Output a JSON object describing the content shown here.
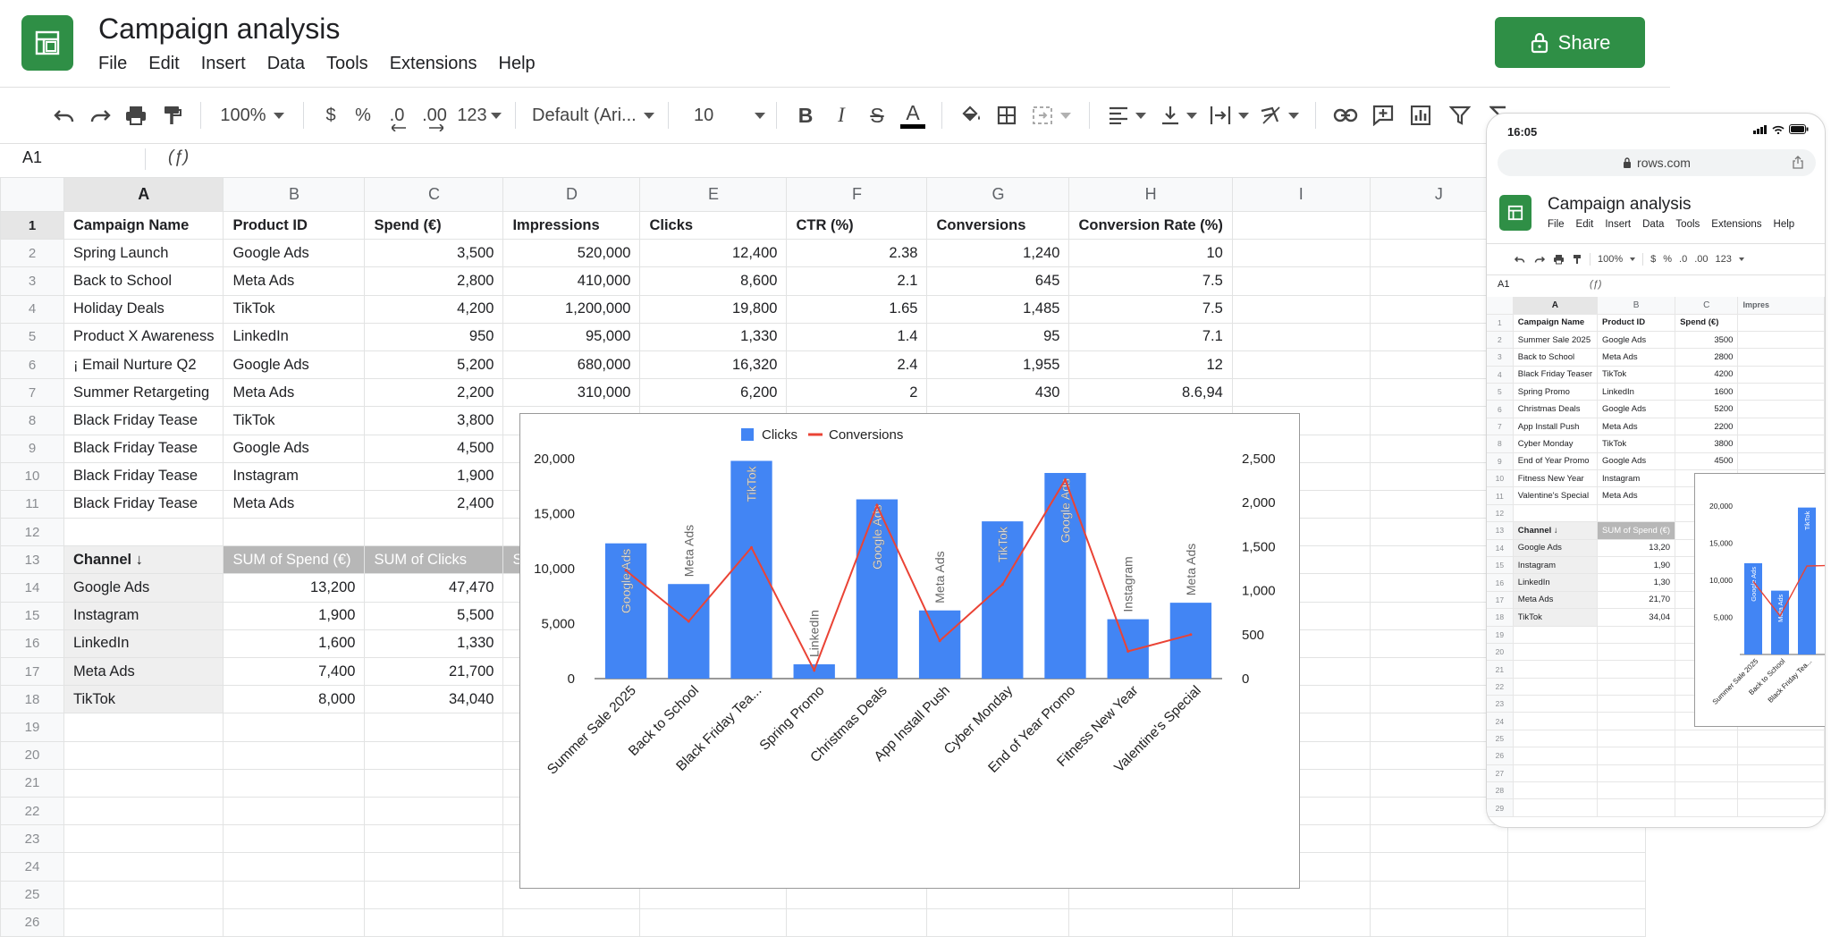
{
  "app": {
    "title": "Campaign analysis",
    "menu": [
      "File",
      "Edit",
      "Insert",
      "Data",
      "Tools",
      "Extensions",
      "Help"
    ],
    "share_label": "Share",
    "brand_color": "#2f8f46"
  },
  "toolbar": {
    "zoom": "100%",
    "currency": "$",
    "percent": "%",
    "decrease_decimals": ".0",
    "increase_decimals": ".00",
    "number_format": "123",
    "font": "Default (Ari...",
    "font_size": "10",
    "bold": "B",
    "italic": "I",
    "strike": "S",
    "text_color": "A"
  },
  "formula_bar": {
    "cell": "A1",
    "fx": "(ƒ)"
  },
  "grid": {
    "columns": [
      "A",
      "B",
      "C",
      "D",
      "E",
      "F",
      "G",
      "H",
      "I",
      "J"
    ],
    "row_numbers": [
      "1",
      "2",
      "3",
      "4",
      "5",
      "6",
      "7",
      "8",
      "9",
      "10",
      "11",
      "12",
      "13",
      "14",
      "15",
      "16",
      "17",
      "18",
      "19",
      "20",
      "21",
      "22",
      "23",
      "24",
      "25",
      "26"
    ],
    "header_row": [
      "Campaign Name",
      "Product ID",
      "Spend (€)",
      "Impressions",
      "Clicks",
      "CTR (%)",
      "Conversions",
      "Conversion Rate (%)"
    ],
    "rows": [
      [
        "Spring Launch",
        "Google Ads",
        "3,500",
        "520,000",
        "12,400",
        "2.38",
        "1,240",
        "10"
      ],
      [
        "Back to School",
        "Meta Ads",
        "2,800",
        "410,000",
        "8,600",
        "2.1",
        "645",
        "7.5"
      ],
      [
        "Holiday Deals",
        "TikTok",
        "4,200",
        "1,200,000",
        "19,800",
        "1.65",
        "1,485",
        "7.5"
      ],
      [
        "Product X Awareness",
        "LinkedIn",
        "950",
        "95,000",
        "1,330",
        "1.4",
        "95",
        "7.1"
      ],
      [
        "¡ Email Nurture Q2",
        "Google Ads",
        "5,200",
        "680,000",
        "16,320",
        "2.4",
        "1,955",
        "12"
      ],
      [
        "Summer Retargeting",
        "Meta Ads",
        "2,200",
        "310,000",
        "6,200",
        "2",
        "430",
        "8.6,94"
      ],
      [
        "Black Friday Tease",
        "TikTok",
        "3,800",
        "",
        "",
        "",
        "",
        ""
      ],
      [
        "Black Friday Tease",
        "Google Ads",
        "4,500",
        "",
        "",
        "",
        "",
        ""
      ],
      [
        "Black Friday Tease",
        "Instagram",
        "1,900",
        "",
        "",
        "",
        "",
        ""
      ],
      [
        "Black Friday Tease",
        "Meta Ads",
        "2,400",
        "",
        "",
        "",
        "",
        ""
      ]
    ],
    "pivot": {
      "headers": [
        "Channel ↓",
        "SUM of Spend (€)",
        "SUM of Clicks",
        "SUM"
      ],
      "rows": [
        [
          "Google Ads",
          "13,200",
          "47,470"
        ],
        [
          "Instagram",
          "1,900",
          "5,500"
        ],
        [
          "LinkedIn",
          "1,600",
          "1,330"
        ],
        [
          "Meta Ads",
          "7,400",
          "21,700"
        ],
        [
          "TikTok",
          "8,000",
          "34,040"
        ]
      ]
    }
  },
  "chart_data": {
    "type": "bar",
    "title": "",
    "legend_position": "top",
    "categories": [
      "Summer Sale 2025",
      "Back to School",
      "Black Friday Tea...",
      "Spring Promo",
      "Christmas Deals",
      "App Install Push",
      "Cyber Monday",
      "End of Year Promo",
      "Fitness New Year",
      "Valentine's Special"
    ],
    "bar_labels": [
      "Google Ads",
      "Meta Ads",
      "TikTok",
      "LinkedIn",
      "Google Ads",
      "Meta Ads",
      "TikTok",
      "Google Ads",
      "Instagram",
      "Meta Ads"
    ],
    "series": [
      {
        "name": "Clicks",
        "type": "bar",
        "axis": "left",
        "color": "#4285f4",
        "values": [
          12300,
          8600,
          19800,
          1300,
          16300,
          6200,
          14300,
          18700,
          5400,
          6900
        ]
      },
      {
        "name": "Conversions",
        "type": "line",
        "axis": "right",
        "color": "#ea4335",
        "values": [
          1230,
          650,
          1490,
          95,
          1970,
          430,
          1070,
          2260,
          310,
          500
        ]
      }
    ],
    "ylim_left": [
      0,
      20000
    ],
    "ylim_right": [
      0,
      2500
    ],
    "yticks_left": [
      "0",
      "5,000",
      "10,000",
      "15,000",
      "20,000"
    ],
    "yticks_right": [
      "0",
      "500",
      "1,000",
      "1,500",
      "2,000",
      "2,500"
    ],
    "grid": false
  },
  "phone": {
    "time": "16:05",
    "url": "rows.com",
    "title": "Campaign analysis",
    "menu": [
      "File",
      "Edit",
      "Insert",
      "Data",
      "Tools",
      "Extensions",
      "Help"
    ],
    "toolbar": {
      "zoom": "100%",
      "currency": "$",
      "percent": "%",
      "decrease_decimals": ".0",
      "increase_decimals": ".00",
      "number_format": "123"
    },
    "formula_bar": {
      "cell": "A1",
      "fx": "(ƒ)"
    },
    "columns": [
      "A",
      "B",
      "C"
    ],
    "extra_col": "Impres",
    "row_numbers": [
      "1",
      "2",
      "3",
      "4",
      "5",
      "6",
      "7",
      "8",
      "9",
      "10",
      "11",
      "12",
      "13",
      "14",
      "15",
      "16",
      "17",
      "18",
      "19",
      "20",
      "21",
      "22",
      "23",
      "24",
      "25",
      "26",
      "27",
      "28",
      "29"
    ],
    "header_row": [
      "Campaign Name",
      "Product ID",
      "Spend (€)"
    ],
    "rows": [
      [
        "Summer Sale 2025",
        "Google Ads",
        "3500"
      ],
      [
        "Back to School",
        "Meta Ads",
        "2800"
      ],
      [
        "Black Friday Teaser",
        "TikTok",
        "4200"
      ],
      [
        "Spring Promo",
        "LinkedIn",
        "1600"
      ],
      [
        "Christmas Deals",
        "Google Ads",
        "5200"
      ],
      [
        "App Install Push",
        "Meta Ads",
        "2200"
      ],
      [
        "Cyber Monday",
        "TikTok",
        "3800"
      ],
      [
        "End of Year Promo",
        "Google Ads",
        "4500"
      ],
      [
        "Fitness New Year",
        "Instagram",
        ""
      ],
      [
        "Valentine's Special",
        "Meta Ads",
        ""
      ]
    ],
    "pivot": {
      "headers": [
        "Channel ↓",
        "SUM of Spend (€)"
      ],
      "rows": [
        [
          "Google Ads",
          "13,20"
        ],
        [
          "Instagram",
          "1,90"
        ],
        [
          "LinkedIn",
          "1,30"
        ],
        [
          "Meta Ads",
          "21,70"
        ],
        [
          "TikTok",
          "34,04"
        ]
      ]
    },
    "chart": {
      "yticks": [
        "5,000",
        "10,000",
        "15,000",
        "20,000"
      ],
      "categories": [
        "Summer Sale 2025",
        "Back to School",
        "Black Friday Tea..."
      ],
      "bar_labels": [
        "Google Ads",
        "Meta Ads",
        "TikTok"
      ],
      "values": [
        12300,
        8600,
        19800
      ],
      "line_values": [
        1230,
        650,
        1490
      ]
    }
  }
}
